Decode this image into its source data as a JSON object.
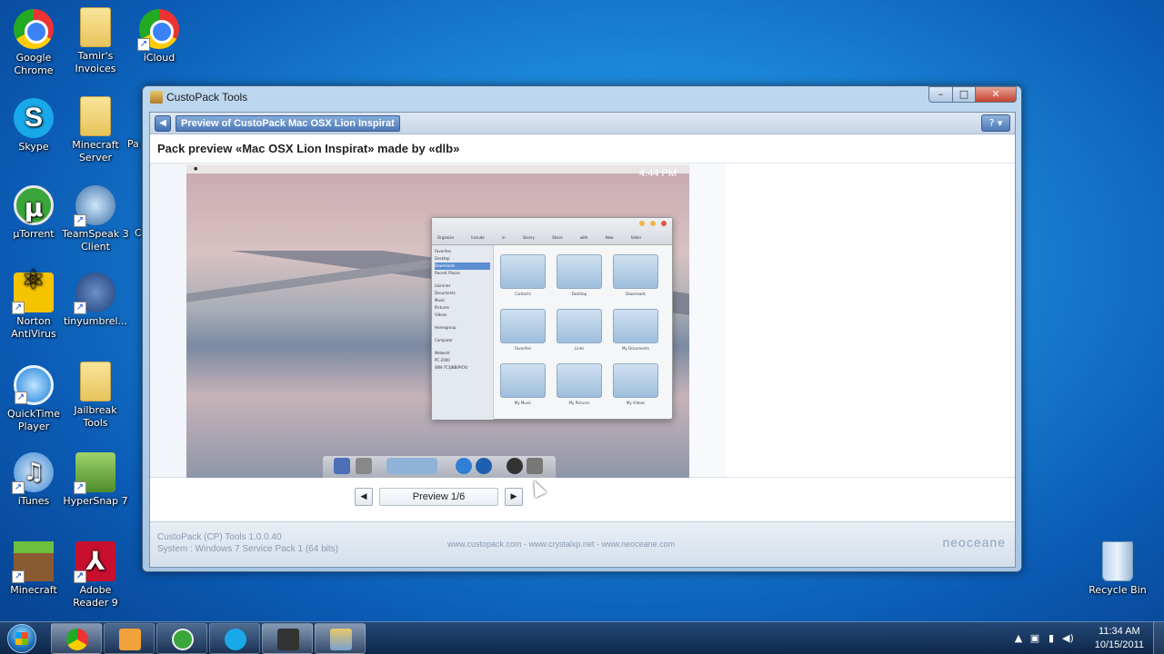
{
  "desktop": {
    "icons": [
      {
        "label": "Google Chrome",
        "icon": "chrome-icon"
      },
      {
        "label": "Tamir's Invoices",
        "icon": "folder-icon"
      },
      {
        "label": "iCloud",
        "icon": "chrome-icon"
      },
      {
        "label": "Skype",
        "icon": "skype-icon"
      },
      {
        "label": "Minecraft Server",
        "icon": "folder-icon"
      },
      {
        "label": "µTorrent",
        "icon": "utorrent-icon"
      },
      {
        "label": "TeamSpeak 3 Client",
        "icon": "teamspeak-icon"
      },
      {
        "label": "Norton AntiVirus",
        "icon": "norton-icon"
      },
      {
        "label": "tinyumbrel...",
        "icon": "umbrella-icon"
      },
      {
        "label": "QuickTime Player",
        "icon": "quicktime-icon"
      },
      {
        "label": "Jailbreak Tools",
        "icon": "folder-icon"
      },
      {
        "label": "iTunes",
        "icon": "itunes-icon"
      },
      {
        "label": "HyperSnap 7",
        "icon": "hypersnap-icon"
      },
      {
        "label": "Minecraft",
        "icon": "minecraft-icon"
      },
      {
        "label": "Adobe Reader 9",
        "icon": "adobe-icon"
      },
      {
        "label": "Recycle Bin",
        "icon": "recycle-bin-icon"
      }
    ],
    "partial_labels": [
      "Pa",
      "C"
    ]
  },
  "window": {
    "title": "CustoPack Tools",
    "controls": {
      "minimize": "–",
      "maximize": "□",
      "close": "✕"
    },
    "breadcrumb": "Preview of CustoPack Mac OSX Lion Inspirat",
    "help": "?",
    "pack_title": "Pack preview «Mac OSX Lion Inspirat» made by «dlb»",
    "preview": {
      "mac_clock": "4:44 PM",
      "finder": {
        "toolbar": [
          "Organize",
          "Include in library",
          "Share with",
          "New folder"
        ],
        "sidebar": [
          "Favorites",
          "Desktop",
          "Downloads",
          "Recent Places",
          "",
          "Libraries",
          "Documents",
          "Music",
          "Pictures",
          "Videos",
          "",
          "Homegroup",
          "",
          "Computer",
          "",
          "Network",
          "PC-2000",
          "WIN-7C3JNB(PICK)"
        ],
        "folders": [
          "Contacts",
          "Desktop",
          "Downloads",
          "Favorites",
          "Links",
          "My Documents",
          "My Music",
          "My Pictures",
          "My Videos"
        ]
      }
    },
    "pager": {
      "prev": "◀",
      "label": "Preview 1/6",
      "next": "▶"
    },
    "footer": {
      "version": "CustoPack (CP) Tools 1.0.0.40",
      "system": "System : Windows 7 Service Pack 1 (64 bits)",
      "links": "www.custopack.com - www.crystalxp.net - www.neoceane.com",
      "logo": "neoceane"
    }
  },
  "taskbar": {
    "pinned": [
      "chrome-icon",
      "outlook-icon",
      "utorrent-icon",
      "skype-icon",
      "media-player-icon",
      "custopack-icon"
    ],
    "clock_time": "11:34 AM",
    "clock_date": "10/15/2011"
  }
}
